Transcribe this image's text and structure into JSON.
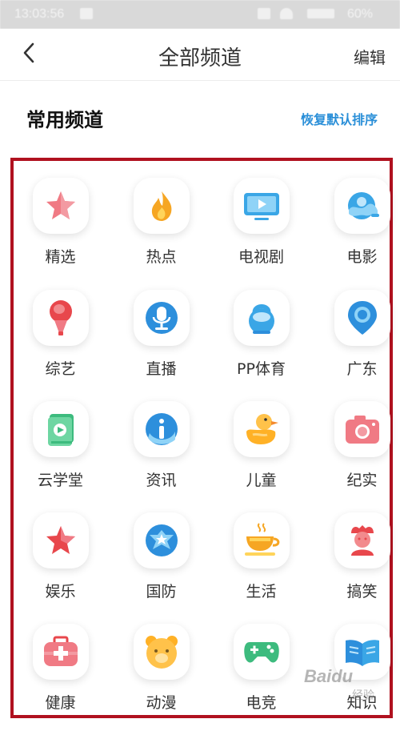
{
  "status_bar": {
    "time": "13:03:56",
    "battery": "60%"
  },
  "nav": {
    "title": "全部频道",
    "edit_label": "编辑"
  },
  "section": {
    "title": "常用频道",
    "reset_label": "恢复默认排序"
  },
  "channels": [
    {
      "label": "精选",
      "icon": "star-icon"
    },
    {
      "label": "热点",
      "icon": "flame-icon"
    },
    {
      "label": "电视剧",
      "icon": "tv-play-icon"
    },
    {
      "label": "电影",
      "icon": "film-wave-icon"
    },
    {
      "label": "综艺",
      "icon": "microphone-icon"
    },
    {
      "label": "直播",
      "icon": "broadcast-mic-icon"
    },
    {
      "label": "PP体育",
      "icon": "kettlebell-icon"
    },
    {
      "label": "广东",
      "icon": "location-pin-icon"
    },
    {
      "label": "云学堂",
      "icon": "book-play-icon"
    },
    {
      "label": "资讯",
      "icon": "info-icon"
    },
    {
      "label": "儿童",
      "icon": "duck-icon"
    },
    {
      "label": "纪实",
      "icon": "camera-icon"
    },
    {
      "label": "娱乐",
      "icon": "star-outline-icon"
    },
    {
      "label": "国防",
      "icon": "military-badge-icon"
    },
    {
      "label": "生活",
      "icon": "coffee-cup-icon"
    },
    {
      "label": "搞笑",
      "icon": "jester-icon"
    },
    {
      "label": "健康",
      "icon": "medical-kit-icon"
    },
    {
      "label": "动漫",
      "icon": "bear-icon"
    },
    {
      "label": "电竞",
      "icon": "gamepad-icon"
    },
    {
      "label": "知识",
      "icon": "open-book-icon"
    }
  ],
  "watermark": {
    "brand": "Baidu",
    "sub": "经验"
  }
}
